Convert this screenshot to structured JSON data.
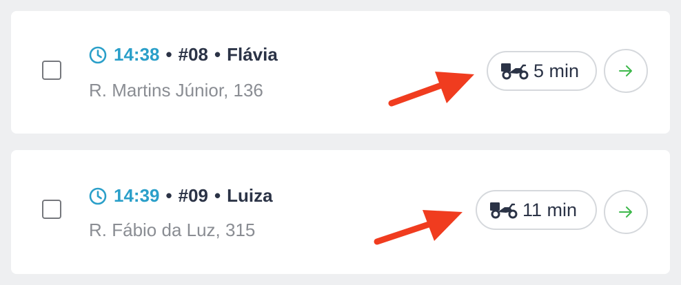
{
  "orders": [
    {
      "time": "14:38",
      "number": "#08",
      "customer": "Flávia",
      "address": "R. Martins Júnior, 136",
      "eta": "5 min"
    },
    {
      "time": "14:39",
      "number": "#09",
      "customer": "Luiza",
      "address": "R. Fábio da Luz, 315",
      "eta": "11 min"
    }
  ],
  "separator": "•",
  "colors": {
    "time_accent": "#2a9fc9",
    "go_arrow": "#3cb84a",
    "annotation": "#f03c1f"
  },
  "icons": {
    "time": "clock-icon",
    "delivery": "motorcycle-icon",
    "go": "arrow-right-icon"
  }
}
